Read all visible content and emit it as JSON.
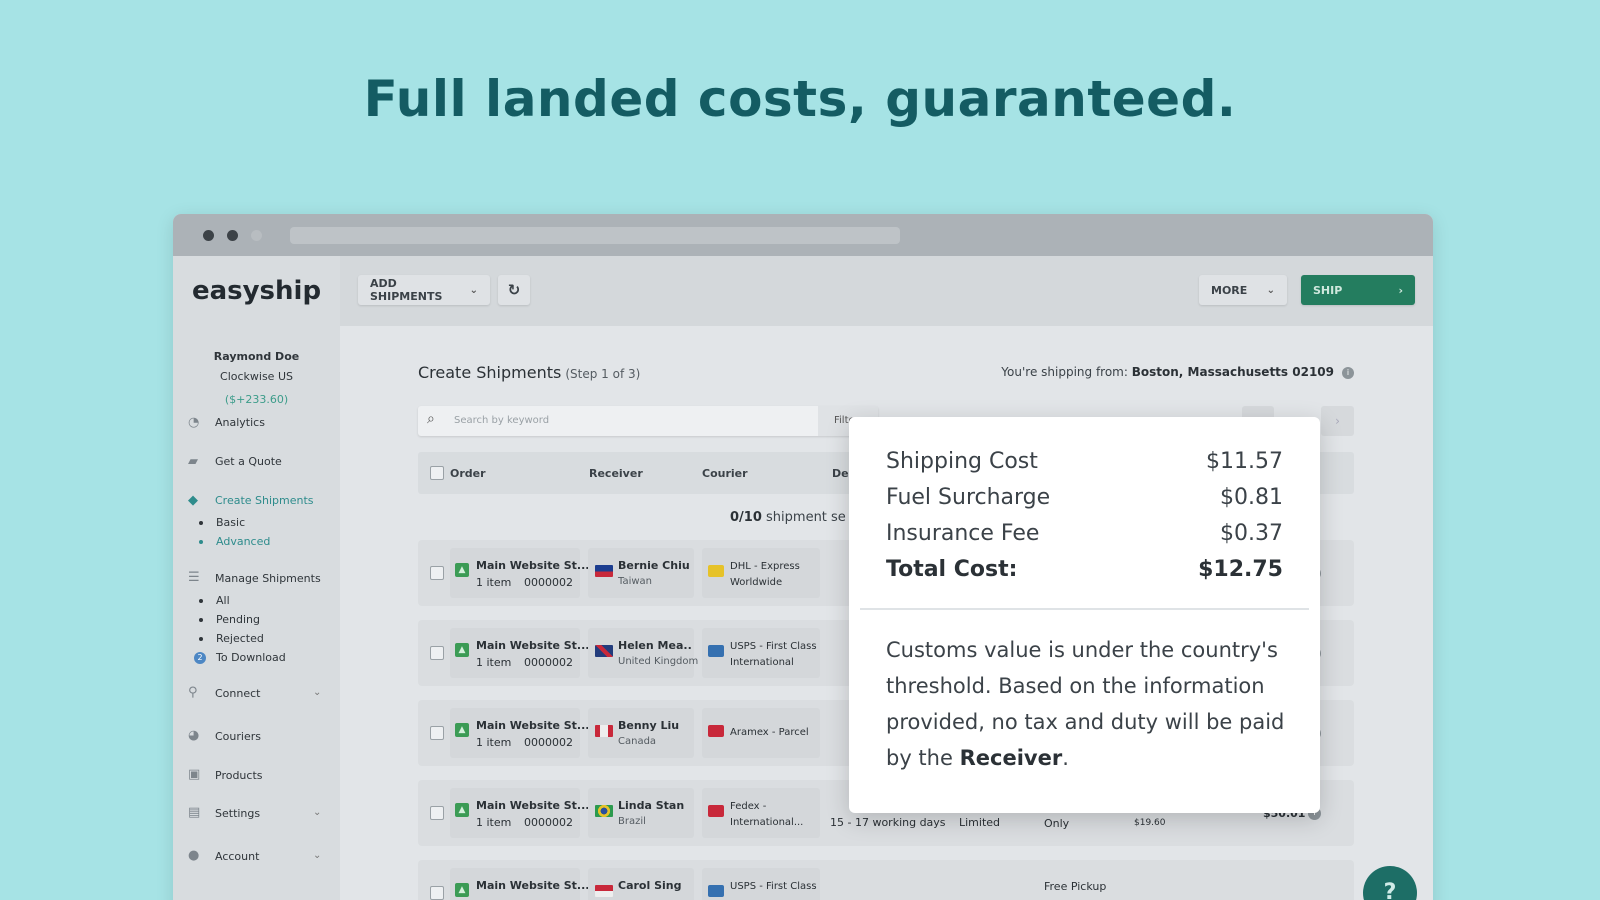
{
  "headline": "Full landed costs, guaranteed.",
  "app": {
    "logo": "easyship"
  },
  "toolbar": {
    "add_shipments": "ADD SHIPMENTS",
    "refresh_icon": "↻",
    "more": "MORE",
    "ship": "SHIP"
  },
  "user": {
    "name": "Raymond Doe",
    "company": "Clockwise US",
    "balance": "($+233.60)"
  },
  "sidebar": {
    "analytics": "Analytics",
    "quote": "Get a Quote",
    "create": "Create Shipments",
    "create_sub": [
      "Basic",
      "Advanced"
    ],
    "manage": "Manage Shipments",
    "manage_sub": [
      "All",
      "Pending",
      "Rejected",
      "To Download"
    ],
    "to_download_count": "2",
    "connect": "Connect",
    "couriers": "Couriers",
    "products": "Products",
    "settings": "Settings",
    "account": "Account"
  },
  "main": {
    "title": "Create Shipments",
    "step": "(Step 1 of 3)",
    "ship_from_label": "You're shipping from:",
    "ship_from_value": "Boston, Massachusetts 02109",
    "search_placeholder": "Search by keyword",
    "filter": "Filte",
    "columns": [
      "Order",
      "Receiver",
      "Courier",
      "De"
    ],
    "selected_count": "0/10",
    "selected_suffix": "shipment se"
  },
  "rows": [
    {
      "order": "Main Website St...",
      "qty": "1 item",
      "num": "0000002",
      "name": "Bernie Chiu",
      "country": "Taiwan",
      "courier": "DHL - Express Worldwide"
    },
    {
      "order": "Main Website St...",
      "qty": "1 item",
      "num": "0000002",
      "name": "Helen Mea..",
      "country": "United Kingdom",
      "courier": "USPS - First Class International"
    },
    {
      "order": "Main Website St...",
      "qty": "1 item",
      "num": "0000002",
      "name": "Benny Liu",
      "country": "Canada",
      "courier": "Aramex - Parcel"
    },
    {
      "order": "Main Website St...",
      "qty": "1 item",
      "num": "0000002",
      "name": "Linda Stan",
      "country": "Brazil",
      "courier": "Fedex - International...",
      "delivery": "15 - 17 working days",
      "tracking": "Limited",
      "pickup": "Free Pickup Only",
      "tax": "$19.60",
      "total": "$50.01"
    },
    {
      "order": "Main Website St...",
      "qty": "",
      "num": "",
      "name": "Carol Sing",
      "country": "",
      "courier": "USPS - First Class",
      "pickup": "Free Pickup"
    }
  ],
  "popup": {
    "shipping_label": "Shipping Cost",
    "shipping_value": "$11.57",
    "fuel_label": "Fuel Surcharge",
    "fuel_value": "$0.81",
    "insurance_label": "Insurance Fee",
    "insurance_value": "$0.37",
    "total_label": "Total Cost:",
    "total_value": "$12.75",
    "note_text": "Customs value is under the country's threshold. Based on the information provided, no tax and duty will be paid by the",
    "note_bold": "Receiver",
    "note_end": "."
  },
  "help": {
    "label": "?"
  },
  "colors": {
    "background": "#a6e3e5",
    "headline": "#145c63",
    "ship_button": "#247d5f",
    "accent_teal": "#2e8c8c"
  }
}
